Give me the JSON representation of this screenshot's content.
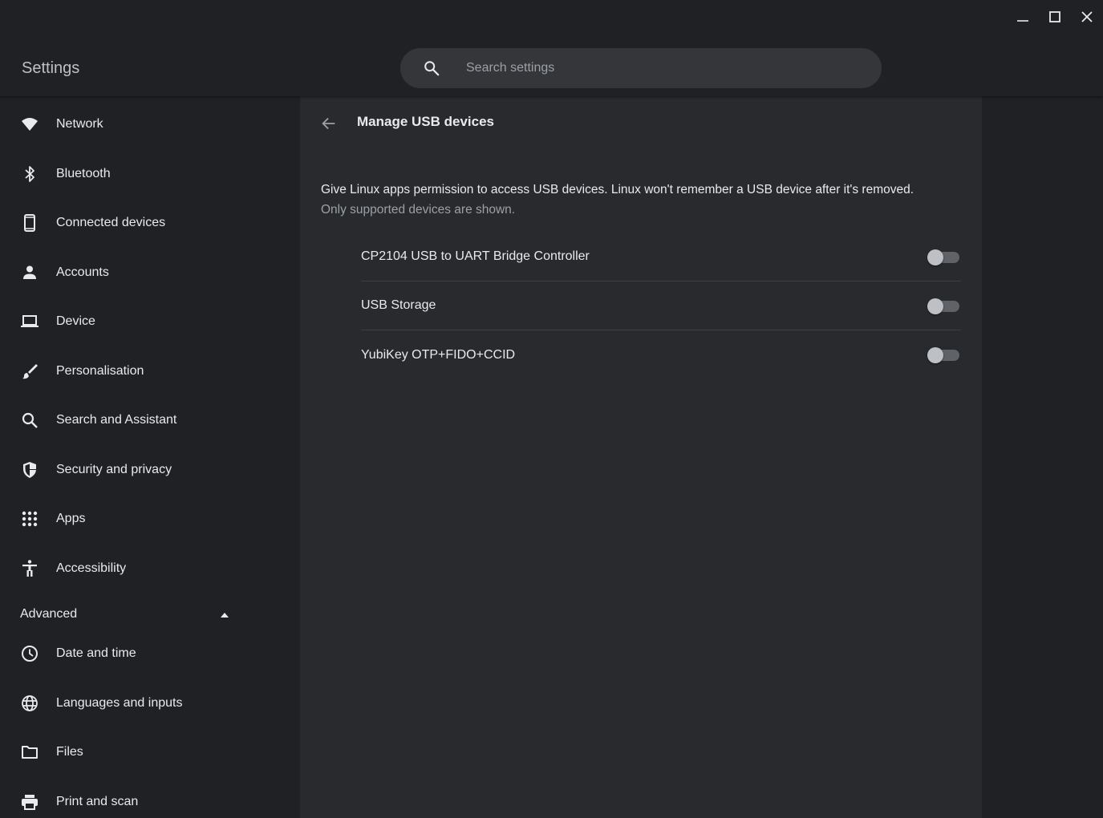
{
  "header": {
    "app_title": "Settings",
    "search_placeholder": "Search settings",
    "search_value": ""
  },
  "sidebar": {
    "items": [
      {
        "label": "Network",
        "icon": "wifi-icon"
      },
      {
        "label": "Bluetooth",
        "icon": "bluetooth-icon"
      },
      {
        "label": "Connected devices",
        "icon": "phone-icon"
      },
      {
        "label": "Accounts",
        "icon": "person-icon"
      },
      {
        "label": "Device",
        "icon": "laptop-icon"
      },
      {
        "label": "Personalisation",
        "icon": "brush-icon"
      },
      {
        "label": "Search and Assistant",
        "icon": "search-icon"
      },
      {
        "label": "Security and privacy",
        "icon": "shield-icon"
      },
      {
        "label": "Apps",
        "icon": "apps-grid-icon"
      },
      {
        "label": "Accessibility",
        "icon": "accessibility-icon"
      }
    ],
    "advanced_label": "Advanced",
    "advanced_items": [
      {
        "label": "Date and time",
        "icon": "clock-icon"
      },
      {
        "label": "Languages and inputs",
        "icon": "globe-icon"
      },
      {
        "label": "Files",
        "icon": "folder-icon"
      },
      {
        "label": "Print and scan",
        "icon": "printer-icon"
      }
    ]
  },
  "main": {
    "page_title": "Manage USB devices",
    "description_primary": "Give Linux apps permission to access USB devices. Linux won't remember a USB device after it's removed.",
    "description_secondary": "Only supported devices are shown.",
    "devices": [
      {
        "label": "CP2104 USB to UART Bridge Controller",
        "enabled": false
      },
      {
        "label": "USB Storage",
        "enabled": false
      },
      {
        "label": "YubiKey OTP+FIDO+CCID",
        "enabled": false
      }
    ]
  },
  "colors": {
    "background": "#202124",
    "card": "#292a2d",
    "text": "#e8eaed",
    "secondary_text": "#9aa0a6",
    "divider": "#3c4043"
  }
}
